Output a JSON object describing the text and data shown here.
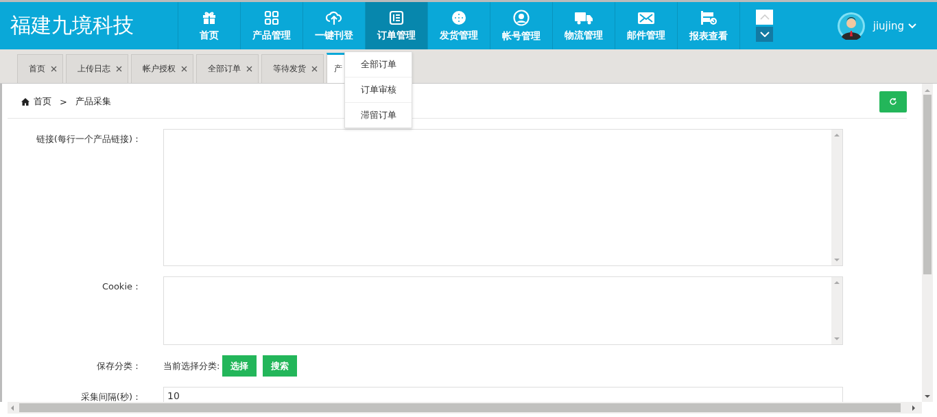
{
  "logo": "福建九境科技",
  "nav": [
    {
      "label": "首页",
      "selected": false
    },
    {
      "label": "产品管理",
      "selected": false
    },
    {
      "label": "一键刊登",
      "selected": false
    },
    {
      "label": "订单管理",
      "selected": true
    },
    {
      "label": "发货管理",
      "selected": false
    },
    {
      "label": "帐号管理",
      "selected": false
    },
    {
      "label": "物流管理",
      "selected": false
    },
    {
      "label": "邮件管理",
      "selected": false
    },
    {
      "label": "报表查看",
      "selected": false
    }
  ],
  "user": {
    "name": "jiujing"
  },
  "tabs": [
    {
      "label": "首页",
      "selected": false
    },
    {
      "label": "上传日志",
      "selected": false
    },
    {
      "label": "帐户授权",
      "selected": false
    },
    {
      "label": "全部订单",
      "selected": false
    },
    {
      "label": "等待发货",
      "selected": false
    },
    {
      "label": "产",
      "selected": true
    }
  ],
  "dropdown": [
    "全部订单",
    "订单审核",
    "滞留订单"
  ],
  "breadcrumb": {
    "home": "首页",
    "separator": ">",
    "current": "产品采集"
  },
  "form": {
    "links_label": "链接(每行一个产品链接)：",
    "cookie_label": "Cookie：",
    "category_label": "保存分类：",
    "category_text": "当前选择分类:",
    "buttons": [
      "选择",
      "搜索"
    ],
    "interval_label": "采集间隔(秒)：",
    "interval_value": "10"
  }
}
